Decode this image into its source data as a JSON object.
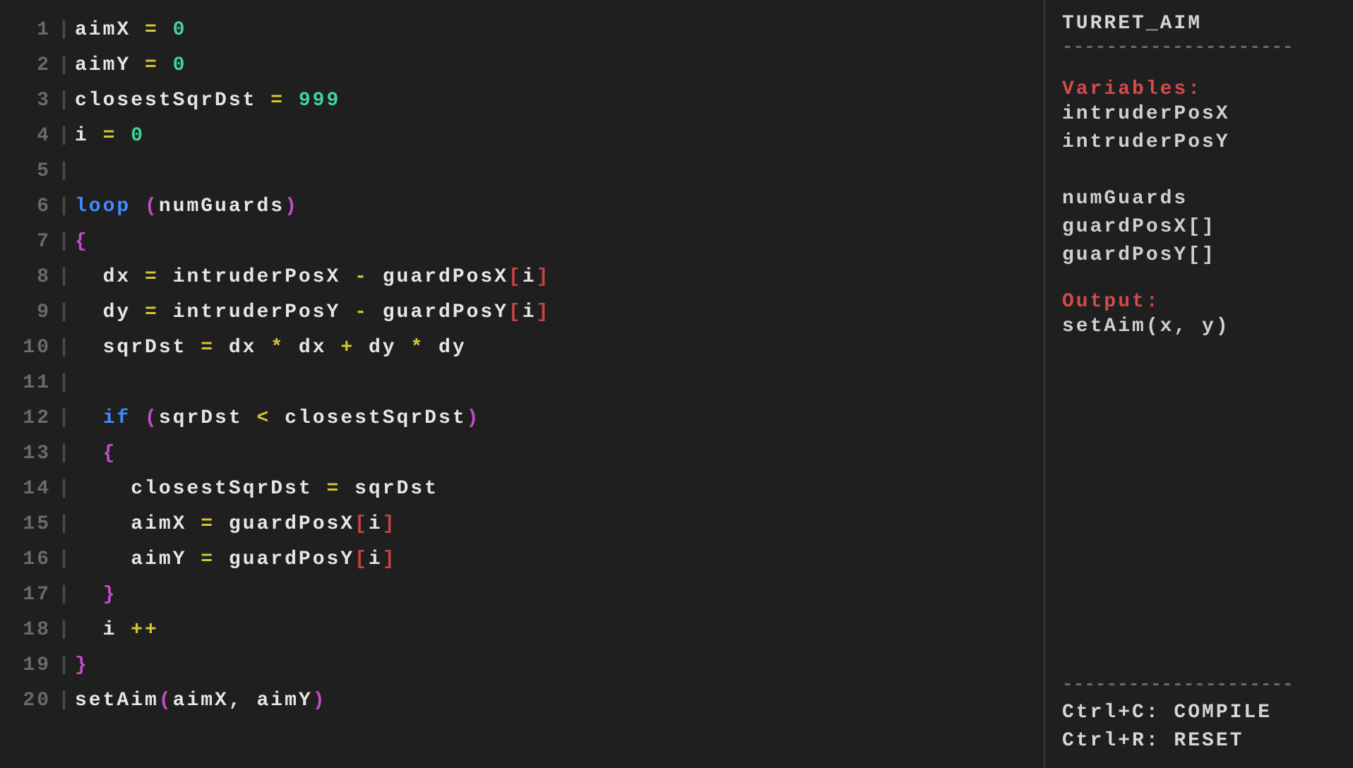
{
  "code_lines": [
    {
      "n": 1,
      "tokens": [
        [
          "id",
          "aimX"
        ],
        [
          "sp",
          " "
        ],
        [
          "op",
          "="
        ],
        [
          "sp",
          " "
        ],
        [
          "num",
          "0"
        ]
      ]
    },
    {
      "n": 2,
      "tokens": [
        [
          "id",
          "aimY"
        ],
        [
          "sp",
          " "
        ],
        [
          "op",
          "="
        ],
        [
          "sp",
          " "
        ],
        [
          "num",
          "0"
        ]
      ]
    },
    {
      "n": 3,
      "tokens": [
        [
          "id",
          "closestSqrDst"
        ],
        [
          "sp",
          " "
        ],
        [
          "op",
          "="
        ],
        [
          "sp",
          " "
        ],
        [
          "num",
          "999"
        ]
      ]
    },
    {
      "n": 4,
      "tokens": [
        [
          "id",
          "i"
        ],
        [
          "sp",
          " "
        ],
        [
          "op",
          "="
        ],
        [
          "sp",
          " "
        ],
        [
          "num",
          "0"
        ]
      ]
    },
    {
      "n": 5,
      "tokens": []
    },
    {
      "n": 6,
      "tokens": [
        [
          "kw",
          "loop"
        ],
        [
          "sp",
          " "
        ],
        [
          "par",
          "("
        ],
        [
          "id",
          "numGuards"
        ],
        [
          "par",
          ")"
        ]
      ]
    },
    {
      "n": 7,
      "tokens": [
        [
          "par",
          "{"
        ]
      ]
    },
    {
      "n": 8,
      "tokens": [
        [
          "sp",
          "  "
        ],
        [
          "id",
          "dx"
        ],
        [
          "sp",
          " "
        ],
        [
          "op",
          "="
        ],
        [
          "sp",
          " "
        ],
        [
          "id",
          "intruderPosX"
        ],
        [
          "sp",
          " "
        ],
        [
          "op",
          "-"
        ],
        [
          "sp",
          " "
        ],
        [
          "id",
          "guardPosX"
        ],
        [
          "br",
          "["
        ],
        [
          "id",
          "i"
        ],
        [
          "br",
          "]"
        ]
      ]
    },
    {
      "n": 9,
      "tokens": [
        [
          "sp",
          "  "
        ],
        [
          "id",
          "dy"
        ],
        [
          "sp",
          " "
        ],
        [
          "op",
          "="
        ],
        [
          "sp",
          " "
        ],
        [
          "id",
          "intruderPosY"
        ],
        [
          "sp",
          " "
        ],
        [
          "op",
          "-"
        ],
        [
          "sp",
          " "
        ],
        [
          "id",
          "guardPosY"
        ],
        [
          "br",
          "["
        ],
        [
          "id",
          "i"
        ],
        [
          "br",
          "]"
        ]
      ]
    },
    {
      "n": 10,
      "tokens": [
        [
          "sp",
          "  "
        ],
        [
          "id",
          "sqrDst"
        ],
        [
          "sp",
          " "
        ],
        [
          "op",
          "="
        ],
        [
          "sp",
          " "
        ],
        [
          "id",
          "dx"
        ],
        [
          "sp",
          " "
        ],
        [
          "op",
          "*"
        ],
        [
          "sp",
          " "
        ],
        [
          "id",
          "dx"
        ],
        [
          "sp",
          " "
        ],
        [
          "op",
          "+"
        ],
        [
          "sp",
          " "
        ],
        [
          "id",
          "dy"
        ],
        [
          "sp",
          " "
        ],
        [
          "op",
          "*"
        ],
        [
          "sp",
          " "
        ],
        [
          "id",
          "dy"
        ]
      ]
    },
    {
      "n": 11,
      "tokens": []
    },
    {
      "n": 12,
      "tokens": [
        [
          "sp",
          "  "
        ],
        [
          "kw",
          "if"
        ],
        [
          "sp",
          " "
        ],
        [
          "par",
          "("
        ],
        [
          "id",
          "sqrDst"
        ],
        [
          "sp",
          " "
        ],
        [
          "op",
          "<"
        ],
        [
          "sp",
          " "
        ],
        [
          "id",
          "closestSqrDst"
        ],
        [
          "par",
          ")"
        ]
      ]
    },
    {
      "n": 13,
      "tokens": [
        [
          "sp",
          "  "
        ],
        [
          "par",
          "{"
        ]
      ]
    },
    {
      "n": 14,
      "tokens": [
        [
          "sp",
          "    "
        ],
        [
          "id",
          "closestSqrDst"
        ],
        [
          "sp",
          " "
        ],
        [
          "op",
          "="
        ],
        [
          "sp",
          " "
        ],
        [
          "id",
          "sqrDst"
        ]
      ]
    },
    {
      "n": 15,
      "tokens": [
        [
          "sp",
          "    "
        ],
        [
          "id",
          "aimX"
        ],
        [
          "sp",
          " "
        ],
        [
          "op",
          "="
        ],
        [
          "sp",
          " "
        ],
        [
          "id",
          "guardPosX"
        ],
        [
          "br",
          "["
        ],
        [
          "id",
          "i"
        ],
        [
          "br",
          "]"
        ]
      ]
    },
    {
      "n": 16,
      "tokens": [
        [
          "sp",
          "    "
        ],
        [
          "id",
          "aimY"
        ],
        [
          "sp",
          " "
        ],
        [
          "op",
          "="
        ],
        [
          "sp",
          " "
        ],
        [
          "id",
          "guardPosY"
        ],
        [
          "br",
          "["
        ],
        [
          "id",
          "i"
        ],
        [
          "br",
          "]"
        ]
      ]
    },
    {
      "n": 17,
      "tokens": [
        [
          "sp",
          "  "
        ],
        [
          "par",
          "}"
        ]
      ]
    },
    {
      "n": 18,
      "tokens": [
        [
          "sp",
          "  "
        ],
        [
          "id",
          "i"
        ],
        [
          "sp",
          " "
        ],
        [
          "op",
          "++"
        ]
      ]
    },
    {
      "n": 19,
      "tokens": [
        [
          "par",
          "}"
        ]
      ]
    },
    {
      "n": 20,
      "tokens": [
        [
          "id",
          "setAim"
        ],
        [
          "par",
          "("
        ],
        [
          "id",
          "aimX"
        ],
        [
          "id",
          ","
        ],
        [
          "sp",
          " "
        ],
        [
          "id",
          "aimY"
        ],
        [
          "par",
          ")"
        ]
      ]
    }
  ],
  "sidebar": {
    "title": "TURRET_AIM",
    "rule": "---------------------",
    "variables_heading": "Variables:",
    "variables": [
      "intruderPosX",
      "intruderPosY",
      "",
      "numGuards",
      "guardPosX[]",
      "guardPosY[]"
    ],
    "output_heading": "Output:",
    "output": "setAim(x, y)",
    "shortcuts": [
      "Ctrl+C: COMPILE",
      "Ctrl+R: RESET"
    ]
  }
}
